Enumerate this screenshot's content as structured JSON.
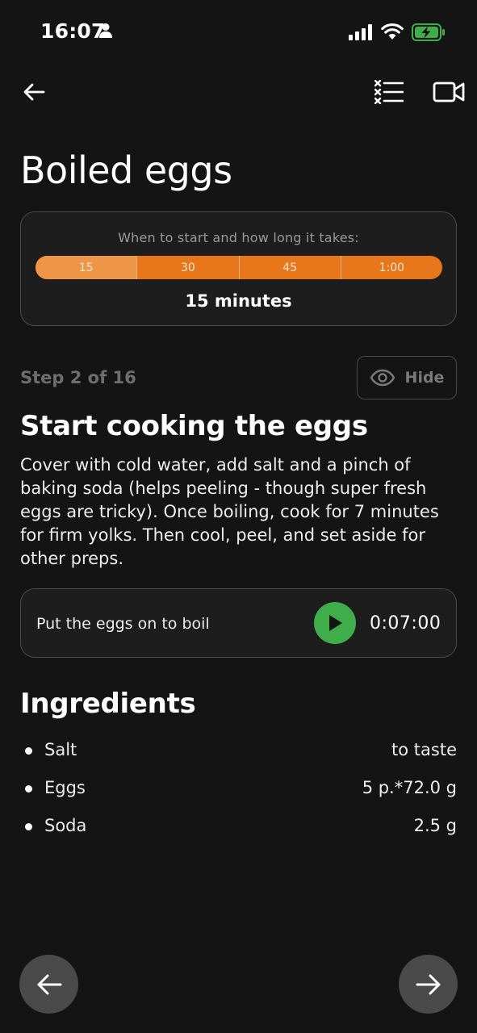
{
  "status_bar": {
    "time": "16:07",
    "person_icon": "person-icon",
    "signal_icon": "signal-icon",
    "wifi_icon": "wifi-icon",
    "battery_icon": "battery-charging-icon",
    "battery_color": "#3fae4a"
  },
  "nav": {
    "back_icon": "arrow-left-icon",
    "checklist_icon": "checklist-icon",
    "video_icon": "video-camera-icon"
  },
  "page": {
    "title": "Boiled eggs"
  },
  "timeline": {
    "caption": "When to start and how long it takes:",
    "segments": [
      "15",
      "30",
      "45",
      "1:00"
    ],
    "active_segment": "15",
    "duration": "15 minutes",
    "bar_color": "#e8761a",
    "active_color": "#ee9648"
  },
  "step": {
    "counter": "Step 2 of 16",
    "hide_label": "Hide",
    "hide_icon": "eye-icon",
    "title": "Start cooking the eggs",
    "description": "Cover with cold water, add salt and a pinch of baking soda (helps peeling - though super fresh eggs are tricky). Once boiling, cook for 7 minutes for firm yolks. Then cool, peel, and set aside for other preps."
  },
  "timer": {
    "label": "Put the eggs on to boil",
    "time": "0:07:00",
    "play_icon": "play-icon",
    "play_color": "#3fae4a"
  },
  "ingredients": {
    "heading": "Ingredients",
    "items": [
      {
        "name": "Salt",
        "amount": "to taste"
      },
      {
        "name": "Eggs",
        "amount": "5 p.*72.0 g"
      },
      {
        "name": "Soda",
        "amount": "2.5 g"
      }
    ]
  },
  "bottom_nav": {
    "prev_icon": "arrow-left-icon",
    "next_icon": "arrow-right-icon"
  }
}
